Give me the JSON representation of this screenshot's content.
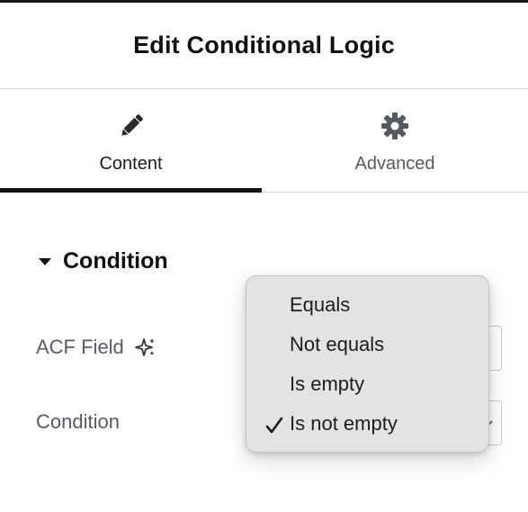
{
  "header": {
    "title": "Edit Conditional Logic"
  },
  "tabs": [
    {
      "label": "Content",
      "icon": "pencil-icon",
      "active": true
    },
    {
      "label": "Advanced",
      "icon": "gear-icon",
      "active": false
    }
  ],
  "section": {
    "title": "Condition",
    "expanded": true
  },
  "fields": {
    "acf_field": {
      "label": "ACF Field",
      "icon": "ai-sparkle-icon"
    },
    "condition": {
      "label": "Condition"
    }
  },
  "dropdown": {
    "options": [
      "Equals",
      "Not equals",
      "Is empty",
      "Is not empty"
    ],
    "selected": "Is not empty"
  },
  "colors": {
    "active_tab_underline": "#111111",
    "dropdown_background": "#e3e3e1",
    "label_text": "#575c63"
  }
}
